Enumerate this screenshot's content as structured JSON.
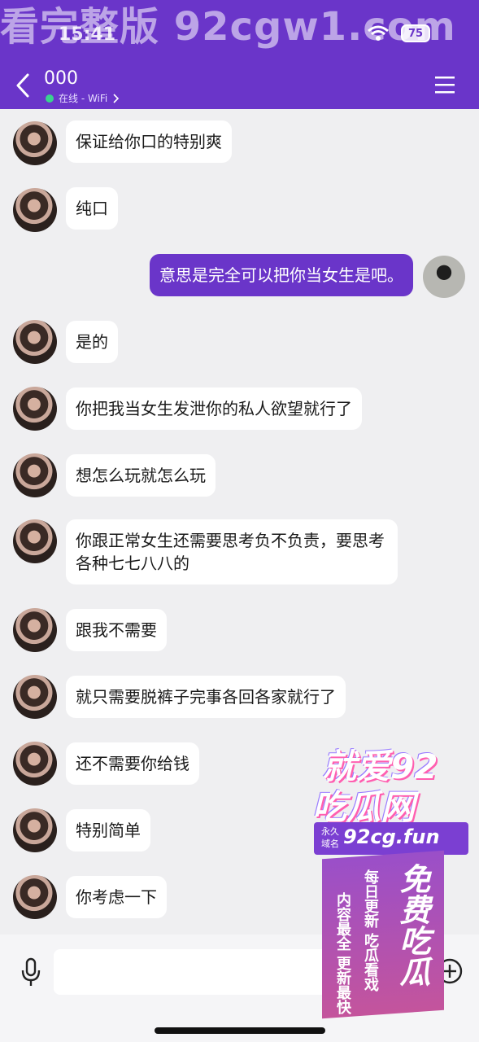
{
  "status_bar": {
    "watermark": "看完整版 92cgw1.com",
    "time": "15:41",
    "battery": "75"
  },
  "header": {
    "title": "000",
    "status": "在线 - WiFi"
  },
  "messages": [
    {
      "sender": "other",
      "text": "保证给你口的特别爽"
    },
    {
      "sender": "other",
      "text": "纯口"
    },
    {
      "sender": "self",
      "text": "意思是完全可以把你当女生是吧。"
    },
    {
      "sender": "other",
      "text": "是的"
    },
    {
      "sender": "other",
      "text": "你把我当女生发泄你的私人欲望就行了"
    },
    {
      "sender": "other",
      "text": "想怎么玩就怎么玩"
    },
    {
      "sender": "other",
      "text": "你跟正常女生还需要思考负不负责，要思考各种七七八八的"
    },
    {
      "sender": "other",
      "text": "跟我不需要"
    },
    {
      "sender": "other",
      "text": "就只需要脱裤子完事各回各家就行了"
    },
    {
      "sender": "other",
      "text": "还不需要你给钱"
    },
    {
      "sender": "other",
      "text": "特别简单"
    },
    {
      "sender": "other",
      "text": "你考虑一下"
    }
  ],
  "input": {
    "value": "",
    "placeholder": ""
  },
  "ad": {
    "line1": "就爱92",
    "line2": "吃瓜网",
    "domain_tag": "永久域名",
    "domain": "92cg.fun",
    "vertical_main": "免费吃瓜",
    "vertical_sub1": "每日更新 吃瓜看戏",
    "vertical_sub2": "内容最全 更新最快"
  },
  "colors": {
    "accent": "#6a35c9",
    "background": "#efeff1",
    "bubble_other": "#ffffff",
    "bubble_self": "#6a35c9"
  },
  "icons": [
    "back-icon",
    "menu-icon",
    "wifi-icon",
    "battery-icon",
    "mic-icon",
    "emoji-icon",
    "add-icon"
  ]
}
